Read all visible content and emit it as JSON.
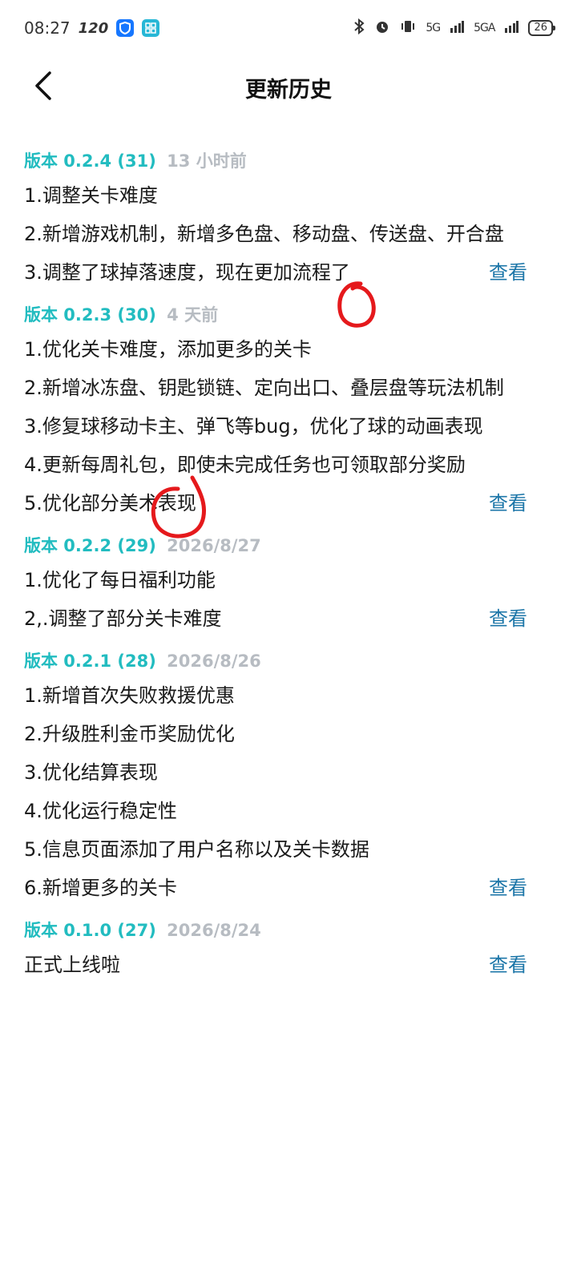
{
  "status_bar": {
    "time": "08:27",
    "refresh_rate": "120",
    "network_5g_a": "5G",
    "network_5g_b": "5GA",
    "battery": "26"
  },
  "header": {
    "title": "更新历史"
  },
  "versions": [
    {
      "label": "版本 0.2.4 (31)",
      "time": "13 小时前",
      "notes": [
        "1.调整关卡难度",
        "2.新增游戏机制，新增多色盘、移动盘、传送盘、开合盘",
        "3.调整了球掉落速度，现在更加流程了"
      ],
      "view": "查看"
    },
    {
      "label": "版本 0.2.3 (30)",
      "time": "4 天前",
      "notes": [
        "1.优化关卡难度，添加更多的关卡",
        "2.新增冰冻盘、钥匙锁链、定向出口、叠层盘等玩法机制",
        "3.修复球移动卡主、弹飞等bug，优化了球的动画表现",
        "4.更新每周礼包，即使未完成任务也可领取部分奖励",
        "5.优化部分美术表现"
      ],
      "view": "查看"
    },
    {
      "label": "版本 0.2.2 (29)",
      "time": "2026/8/27",
      "notes": [
        "1.优化了每日福利功能",
        "2,.调整了部分关卡难度"
      ],
      "view": "查看"
    },
    {
      "label": "版本 0.2.1 (28)",
      "time": "2026/8/26",
      "notes": [
        "1.新增首次失败救援优惠",
        "2.升级胜利金币奖励优化",
        "3.优化结算表现",
        "4.优化运行稳定性",
        "5.信息页面添加了用户名称以及关卡数据",
        "6.新增更多的关卡"
      ],
      "view": "查看"
    },
    {
      "label": "版本 0.1.0 (27)",
      "time": "2026/8/24",
      "notes": [
        "正式上线啦"
      ],
      "view": "查看"
    }
  ],
  "colors": {
    "accent": "#22bcc0",
    "link": "#1c76a8",
    "muted": "#b7bcc2",
    "annotation": "#e5191c"
  }
}
